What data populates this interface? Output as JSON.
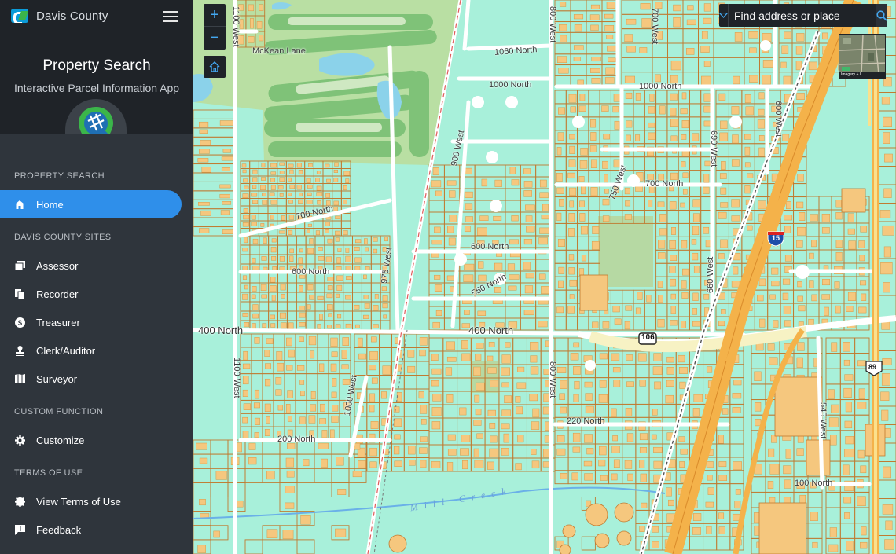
{
  "brand": {
    "name": "Davis County"
  },
  "app": {
    "title": "Property Search",
    "subtitle": "Interactive Parcel Information App"
  },
  "nav": {
    "sections": [
      {
        "label": "PROPERTY SEARCH",
        "items": [
          {
            "label": "Home",
            "icon": "home-icon",
            "active": true
          }
        ]
      },
      {
        "label": "DAVIS COUNTY SITES",
        "items": [
          {
            "label": "Assessor",
            "icon": "gallery-icon"
          },
          {
            "label": "Recorder",
            "icon": "copy-icon"
          },
          {
            "label": "Treasurer",
            "icon": "dollar-icon"
          },
          {
            "label": "Clerk/Auditor",
            "icon": "stamp-icon"
          },
          {
            "label": "Surveyor",
            "icon": "map-icon"
          }
        ]
      },
      {
        "label": "CUSTOM FUNCTION",
        "items": [
          {
            "label": "Customize",
            "icon": "gear-icon"
          }
        ]
      },
      {
        "label": "TERMS OF USE",
        "items": [
          {
            "label": "View Terms of Use",
            "icon": "badge-icon"
          },
          {
            "label": "Feedback",
            "icon": "feedback-icon"
          }
        ]
      }
    ]
  },
  "search": {
    "placeholder": "Find address or place"
  },
  "basemap": {
    "caption": "Imagery + L"
  },
  "map": {
    "labels": {
      "mckean": "McKean Lane",
      "n1060": "1060 North",
      "n1000a": "1000 North",
      "n1000b": "1000 North",
      "n700a": "700 North",
      "n700b": "700 North",
      "n600a": "600 North",
      "n600b": "600 North",
      "n550": "550 North",
      "n400a": "400 North",
      "n400b": "400 North",
      "n220": "220 North",
      "n200": "200 North",
      "n100": "100 North",
      "w1100a": "1100 West",
      "w1100b": "1100 West",
      "w1000": "1000 West",
      "w975": "975 West",
      "w900": "900 West",
      "w800a": "800 West",
      "w800b": "800 West",
      "w750": "750 West",
      "w700": "700 West",
      "w690": "690 West",
      "w660": "660 West",
      "w600": "600 West",
      "w545": "545 West",
      "creek": "Mill Creek",
      "hwy106": "106",
      "hwy15": "15",
      "hwy89": "89"
    }
  },
  "colors": {
    "accent": "#2f8fea",
    "sidebar": "#2f353c",
    "land": "#a8f0da",
    "parcel": "#c07a30",
    "building": "#f5c77e",
    "road": "#ffffff",
    "highway": "#f4b24a"
  }
}
